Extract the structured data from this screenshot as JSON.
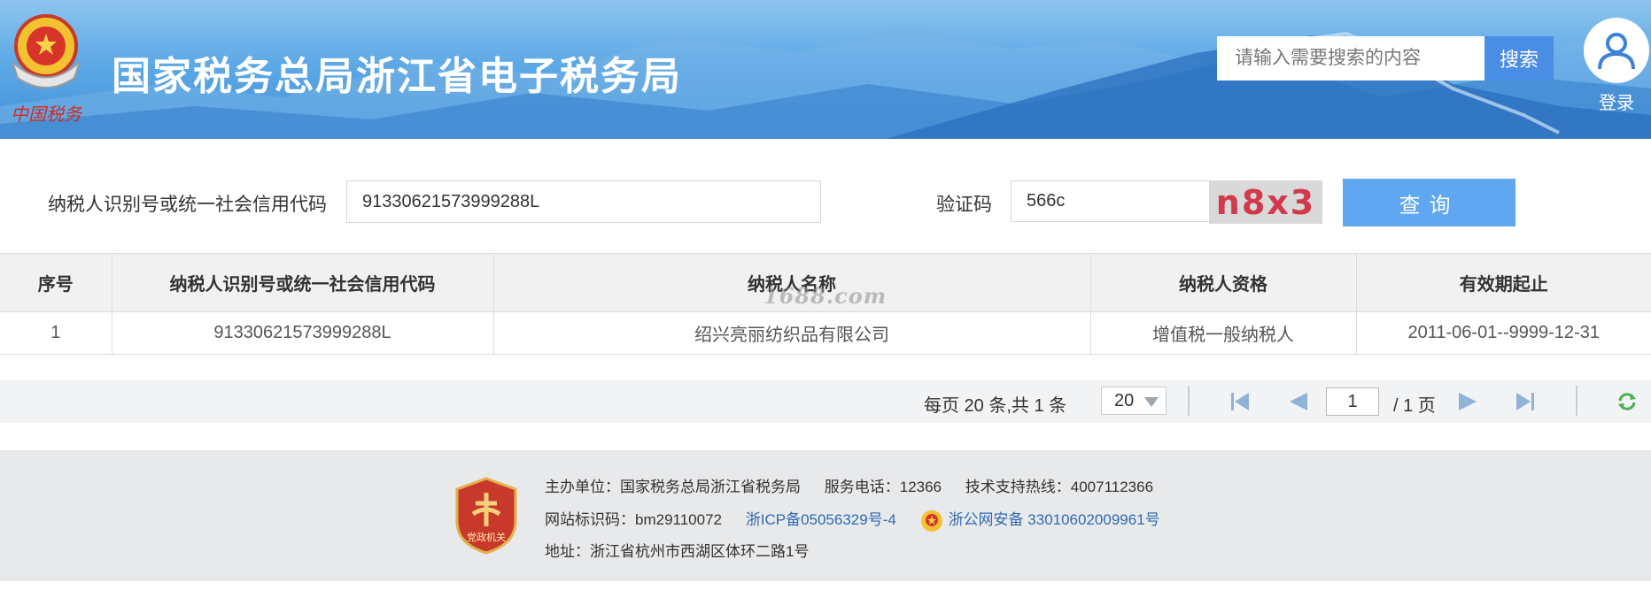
{
  "header": {
    "emblem_text": "中国税务",
    "site_title": "国家税务总局浙江省电子税务局",
    "search_placeholder": "请输入需要搜索的内容",
    "search_button": "搜索",
    "login_label": "登录"
  },
  "query": {
    "taxpayer_id_label": "纳税人识别号或统一社会信用代码",
    "taxpayer_id_value": "91330621573999288L",
    "captcha_label": "验证码",
    "captcha_value": "566c",
    "captcha_image_text": "n8x3",
    "query_button": "查询"
  },
  "table": {
    "headers": [
      "序号",
      "纳税人识别号或统一社会信用代码",
      "纳税人名称",
      "纳税人资格",
      "有效期起止"
    ],
    "rows": [
      [
        "1",
        "91330621573999288L",
        "绍兴亮丽纺织品有限公司",
        "增值税一般纳税人",
        "2011-06-01--9999-12-31"
      ]
    ],
    "watermark": "1688.com"
  },
  "pager": {
    "info": "每页 20 条,共 1 条",
    "page_size": "20",
    "current_page": "1",
    "total_pages": "/ 1 页"
  },
  "footer": {
    "badge_text": "党政机关",
    "sponsor": "主办单位：国家税务总局浙江省税务局",
    "phone": "服务电话：12366",
    "hotline": "技术支持热线：4007112366",
    "site_code": "网站标识码：bm29110072",
    "icp": "浙ICP备05056329号-4",
    "police": "浙公网安备 33010602009961号",
    "address": "地址：浙江省杭州市西湖区体环二路1号"
  },
  "colors": {
    "header_blue": "#3f8fda",
    "search_button": "#4a8de4",
    "query_button": "#5fa7f0",
    "link": "#2f6bb0",
    "captcha_text": "#d23a4b"
  }
}
